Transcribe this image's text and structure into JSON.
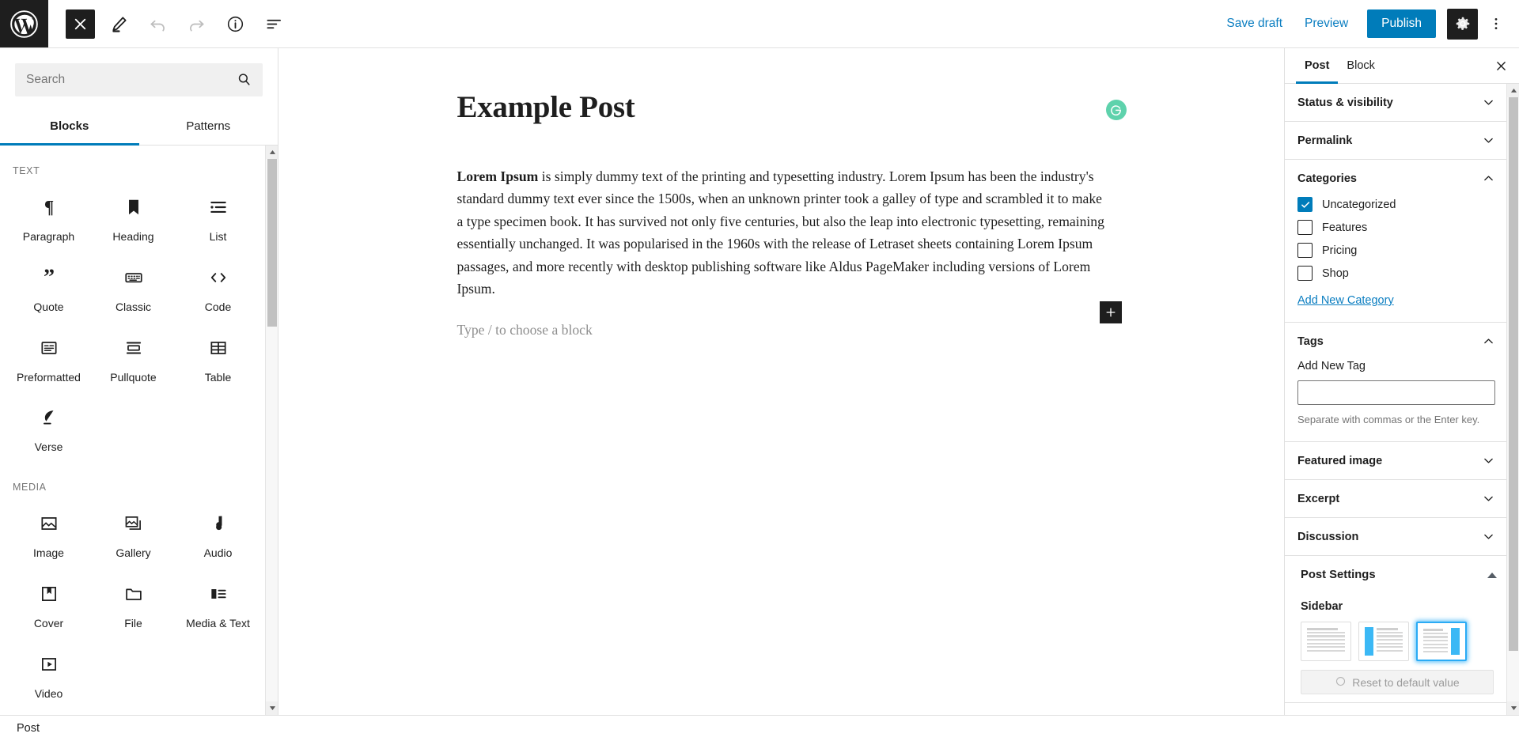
{
  "header": {
    "logo_icon": "wordpress-logo-icon",
    "tools": [
      {
        "name": "close-editor-button",
        "icon": "close-icon",
        "state": "dark"
      },
      {
        "name": "edit-mode-button",
        "icon": "pencil-icon",
        "state": "normal"
      },
      {
        "name": "undo-button",
        "icon": "undo-arrow-icon",
        "state": "disabled"
      },
      {
        "name": "redo-button",
        "icon": "redo-arrow-icon",
        "state": "disabled"
      },
      {
        "name": "details-button",
        "icon": "info-circle-icon",
        "state": "normal"
      },
      {
        "name": "list-view-button",
        "icon": "list-view-icon",
        "state": "normal"
      }
    ],
    "save_draft_label": "Save draft",
    "preview_label": "Preview",
    "publish_label": "Publish",
    "settings_icon": "gear-icon",
    "more_icon": "three-dots-vertical-icon",
    "accent_blue": "#007cba",
    "dark": "#1e1e1e"
  },
  "inserter": {
    "search": {
      "placeholder": "Search",
      "value": "",
      "icon": "search-icon"
    },
    "tabs": [
      {
        "label": "Blocks",
        "active": true
      },
      {
        "label": "Patterns",
        "active": false
      }
    ],
    "sections": [
      {
        "title": "TEXT",
        "blocks": [
          {
            "label": "Paragraph",
            "icon": "paragraph-pilcrow-icon"
          },
          {
            "label": "Heading",
            "icon": "heading-bookmark-icon"
          },
          {
            "label": "List",
            "icon": "bulleted-list-icon"
          },
          {
            "label": "Quote",
            "icon": "quotation-marks-icon"
          },
          {
            "label": "Classic",
            "icon": "keyboard-icon"
          },
          {
            "label": "Code",
            "icon": "angle-brackets-icon"
          },
          {
            "label": "Preformatted",
            "icon": "preformatted-box-icon"
          },
          {
            "label": "Pullquote",
            "icon": "pullquote-bars-icon"
          },
          {
            "label": "Table",
            "icon": "table-grid-icon"
          },
          {
            "label": "Verse",
            "icon": "feather-quill-icon"
          }
        ]
      },
      {
        "title": "MEDIA",
        "blocks": [
          {
            "label": "Image",
            "icon": "image-icon"
          },
          {
            "label": "Gallery",
            "icon": "gallery-stack-icon"
          },
          {
            "label": "Audio",
            "icon": "music-note-icon"
          },
          {
            "label": "Cover",
            "icon": "cover-bookmark-icon"
          },
          {
            "label": "File",
            "icon": "folder-icon"
          },
          {
            "label": "Media & Text",
            "icon": "media-and-text-icon"
          },
          {
            "label": "Video",
            "icon": "video-play-icon"
          }
        ]
      }
    ]
  },
  "editor": {
    "post_title": "Example Post",
    "grammarly_icon": "grammarly-g-icon",
    "paragraph_bold_lead": "Lorem Ipsum",
    "paragraph_rest": " is simply dummy text of the printing and typesetting industry. Lorem Ipsum has been the industry's standard dummy text ever since the 1500s, when an unknown printer took a galley of type and scrambled it to make a type specimen book. It has survived not only five centuries, but also the leap into electronic typesetting, remaining essentially unchanged. It was popularised in the 1960s with the release of Letraset sheets containing Lorem Ipsum passages, and more recently with desktop publishing software like Aldus PageMaker including versions of Lorem Ipsum.",
    "block_placeholder": "Type / to choose a block",
    "add_block_icon": "plus-icon"
  },
  "settings": {
    "tabs": [
      {
        "label": "Post",
        "active": true
      },
      {
        "label": "Block",
        "active": false
      }
    ],
    "close_icon": "close-icon",
    "panels": [
      {
        "title": "Status & visibility",
        "expanded": false,
        "icon": "chevron-down-icon"
      },
      {
        "title": "Permalink",
        "expanded": false,
        "icon": "chevron-down-icon"
      },
      {
        "title": "Categories",
        "expanded": true,
        "icon": "chevron-up-icon"
      },
      {
        "title": "Tags",
        "expanded": true,
        "icon": "chevron-up-icon"
      },
      {
        "title": "Featured image",
        "expanded": false,
        "icon": "chevron-down-icon"
      },
      {
        "title": "Excerpt",
        "expanded": false,
        "icon": "chevron-down-icon"
      },
      {
        "title": "Discussion",
        "expanded": false,
        "icon": "chevron-down-icon"
      }
    ],
    "categories": {
      "title": "Categories",
      "items": [
        {
          "label": "Uncategorized",
          "checked": true
        },
        {
          "label": "Features",
          "checked": false
        },
        {
          "label": "Pricing",
          "checked": false
        },
        {
          "label": "Shop",
          "checked": false
        }
      ],
      "add_new_label": "Add New Category"
    },
    "tags": {
      "title": "Tags",
      "field_label": "Add New Tag",
      "input_value": "",
      "help_text": "Separate with commas or the Enter key."
    },
    "featured_image_title": "Featured image",
    "excerpt_title": "Excerpt",
    "discussion_title": "Discussion",
    "post_settings": {
      "title": "Post Settings",
      "sidebar_label": "Sidebar",
      "layout_options": [
        {
          "name": "no-sidebar",
          "selected": false
        },
        {
          "name": "left-sidebar",
          "selected": false
        },
        {
          "name": "right-sidebar",
          "selected": true
        }
      ],
      "reset_label": "Reset to default value",
      "reset_icon": "reset-circle-icon"
    }
  },
  "statusbar": {
    "breadcrumb": "Post"
  }
}
